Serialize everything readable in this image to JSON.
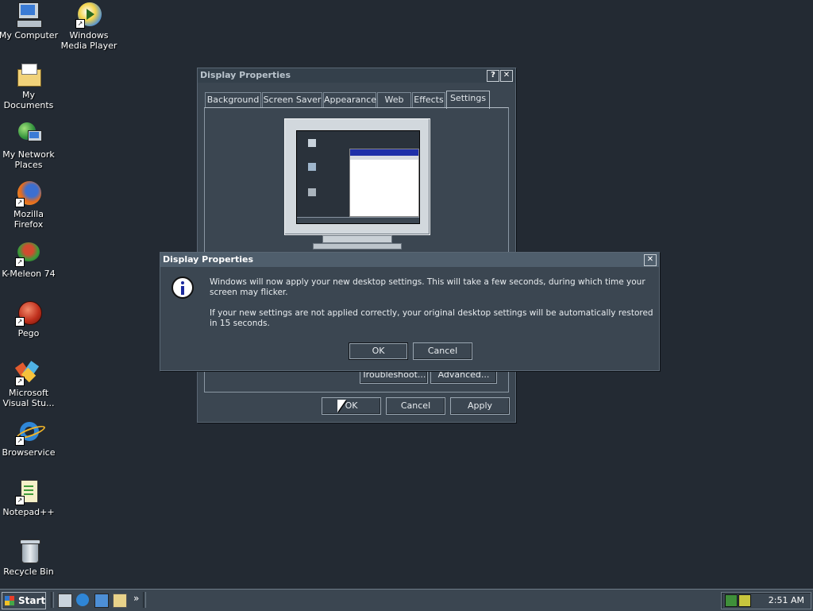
{
  "desktop_icons": [
    {
      "label": "My Computer"
    },
    {
      "label": "Windows Media Player"
    },
    {
      "label": "My Documents"
    },
    {
      "label": "My Network Places"
    },
    {
      "label": "Mozilla Firefox"
    },
    {
      "label": "K-Meleon 74"
    },
    {
      "label": "Pego"
    },
    {
      "label": "Microsoft Visual Stu..."
    },
    {
      "label": "Browservice"
    },
    {
      "label": "Notepad++"
    },
    {
      "label": "Recycle Bin"
    }
  ],
  "display_window": {
    "title": "Display Properties",
    "help_glyph": "?",
    "close_glyph": "✕",
    "tabs": [
      "Background",
      "Screen Saver",
      "Appearance",
      "Web",
      "Effects",
      "Settings"
    ],
    "active_tab": "Settings",
    "troubleshoot_label": "Troubleshoot...",
    "advanced_label": "Advanced...",
    "ok_label": "OK",
    "cancel_label": "Cancel",
    "apply_label": "Apply"
  },
  "message_dialog": {
    "title": "Display Properties",
    "close_glyph": "✕",
    "icon": "info-icon",
    "message_1": "Windows will now apply your new desktop settings. This will take a few seconds, during which time your screen may flicker.",
    "message_2": "If your new settings are not applied correctly, your original desktop settings will be automatically restored in 15 seconds.",
    "ok_label": "OK",
    "cancel_label": "Cancel"
  },
  "taskbar": {
    "start_label": "Start",
    "chevron": "»",
    "clock": "2:51 AM"
  },
  "colors": {
    "desktop": "#232a33",
    "window_face": "#3b4651",
    "titlebar": "#34404b",
    "dialog_title": "#4f5e6c"
  }
}
